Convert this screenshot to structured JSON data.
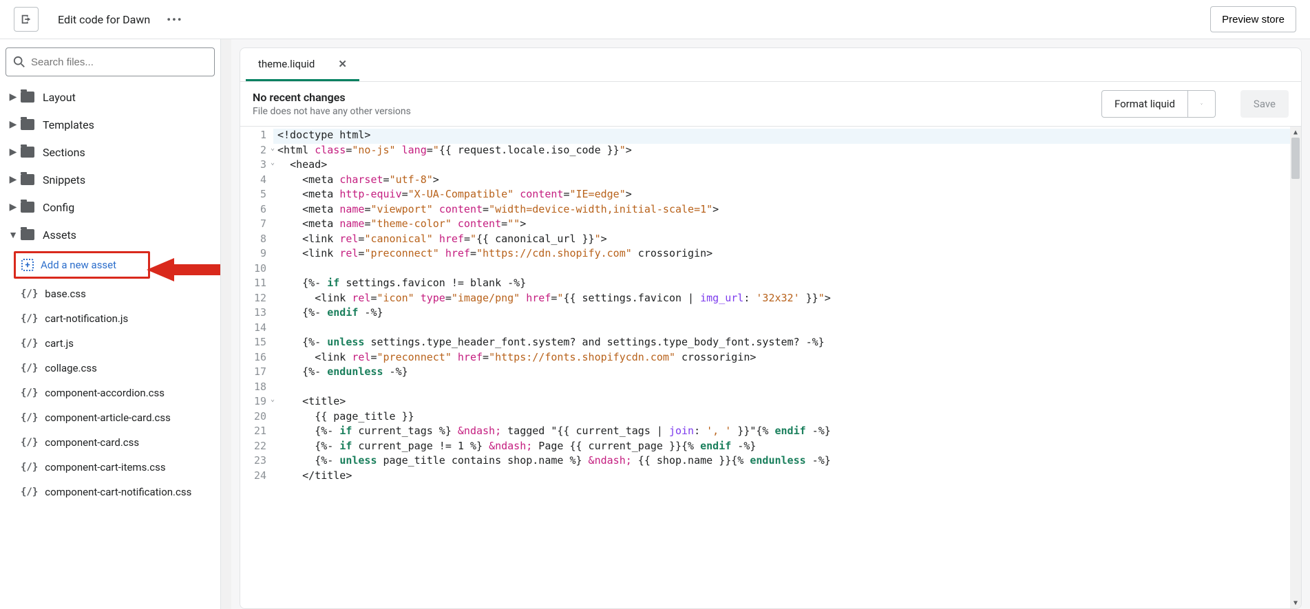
{
  "header": {
    "title": "Edit code for Dawn",
    "preview": "Preview store"
  },
  "search": {
    "placeholder": "Search files..."
  },
  "folders": [
    {
      "label": "Layout",
      "expanded": false
    },
    {
      "label": "Templates",
      "expanded": false
    },
    {
      "label": "Sections",
      "expanded": false
    },
    {
      "label": "Snippets",
      "expanded": false
    },
    {
      "label": "Config",
      "expanded": false
    },
    {
      "label": "Assets",
      "expanded": true
    }
  ],
  "add_asset": "Add a new asset",
  "files": [
    "base.css",
    "cart-notification.js",
    "cart.js",
    "collage.css",
    "component-accordion.css",
    "component-article-card.css",
    "component-card.css",
    "component-cart-items.css",
    "component-cart-notification.css"
  ],
  "tab": {
    "name": "theme.liquid"
  },
  "status": {
    "title": "No recent changes",
    "sub": "File does not have any other versions"
  },
  "actions": {
    "format": "Format liquid",
    "save": "Save"
  },
  "code_lines": [
    {
      "n": 1,
      "fold": false,
      "html": "<span class='t-txt'>&lt;!doctype html&gt;</span>"
    },
    {
      "n": 2,
      "fold": true,
      "html": "<span class='t-txt'>&lt;html </span><span class='t-attr'>class</span><span class='t-txt'>=</span><span class='t-str'>\"no-js\"</span><span class='t-txt'> </span><span class='t-attr'>lang</span><span class='t-txt'>=</span><span class='t-str'>\"</span><span class='t-txt'>{{ request.locale.iso_code }}</span><span class='t-str'>\"</span><span class='t-txt'>&gt;</span>"
    },
    {
      "n": 3,
      "fold": true,
      "html": "  <span class='t-txt'>&lt;head&gt;</span>"
    },
    {
      "n": 4,
      "fold": false,
      "html": "    <span class='t-txt'>&lt;meta </span><span class='t-attr'>charset</span><span class='t-txt'>=</span><span class='t-str'>\"utf-8\"</span><span class='t-txt'>&gt;</span>"
    },
    {
      "n": 5,
      "fold": false,
      "html": "    <span class='t-txt'>&lt;meta </span><span class='t-attr'>http-equiv</span><span class='t-txt'>=</span><span class='t-str'>\"X-UA-Compatible\"</span><span class='t-txt'> </span><span class='t-attr'>content</span><span class='t-txt'>=</span><span class='t-str'>\"IE=edge\"</span><span class='t-txt'>&gt;</span>"
    },
    {
      "n": 6,
      "fold": false,
      "html": "    <span class='t-txt'>&lt;meta </span><span class='t-attr'>name</span><span class='t-txt'>=</span><span class='t-str'>\"viewport\"</span><span class='t-txt'> </span><span class='t-attr'>content</span><span class='t-txt'>=</span><span class='t-str'>\"width=device-width,initial-scale=1\"</span><span class='t-txt'>&gt;</span>"
    },
    {
      "n": 7,
      "fold": false,
      "html": "    <span class='t-txt'>&lt;meta </span><span class='t-attr'>name</span><span class='t-txt'>=</span><span class='t-str'>\"theme-color\"</span><span class='t-txt'> </span><span class='t-attr'>content</span><span class='t-txt'>=</span><span class='t-str'>\"\"</span><span class='t-txt'>&gt;</span>"
    },
    {
      "n": 8,
      "fold": false,
      "html": "    <span class='t-txt'>&lt;link </span><span class='t-attr'>rel</span><span class='t-txt'>=</span><span class='t-str'>\"canonical\"</span><span class='t-txt'> </span><span class='t-attr'>href</span><span class='t-txt'>=</span><span class='t-str'>\"</span><span class='t-txt'>{{ canonical_url }}</span><span class='t-str'>\"</span><span class='t-txt'>&gt;</span>"
    },
    {
      "n": 9,
      "fold": false,
      "html": "    <span class='t-txt'>&lt;link </span><span class='t-attr'>rel</span><span class='t-txt'>=</span><span class='t-str'>\"preconnect\"</span><span class='t-txt'> </span><span class='t-attr'>href</span><span class='t-txt'>=</span><span class='t-str'>\"https://cdn.shopify.com\"</span><span class='t-txt'> crossorigin&gt;</span>"
    },
    {
      "n": 10,
      "fold": false,
      "html": ""
    },
    {
      "n": 11,
      "fold": false,
      "html": "    <span class='t-txt'>{%- </span><span class='t-kw'>if</span><span class='t-txt'> settings.favicon != blank -%}</span>"
    },
    {
      "n": 12,
      "fold": false,
      "html": "      <span class='t-txt'>&lt;link </span><span class='t-attr'>rel</span><span class='t-txt'>=</span><span class='t-str'>\"icon\"</span><span class='t-txt'> </span><span class='t-attr'>type</span><span class='t-txt'>=</span><span class='t-str'>\"image/png\"</span><span class='t-txt'> </span><span class='t-attr'>href</span><span class='t-txt'>=</span><span class='t-str'>\"</span><span class='t-txt'>{{ settings.favicon | </span><span class='t-fn'>img_url</span><span class='t-txt'>: </span><span class='t-str'>'32x32'</span><span class='t-txt'> }}</span><span class='t-str'>\"</span><span class='t-txt'>&gt;</span>"
    },
    {
      "n": 13,
      "fold": false,
      "html": "    <span class='t-txt'>{%- </span><span class='t-kw'>endif</span><span class='t-txt'> -%}</span>"
    },
    {
      "n": 14,
      "fold": false,
      "html": ""
    },
    {
      "n": 15,
      "fold": false,
      "html": "    <span class='t-txt'>{%- </span><span class='t-kw'>unless</span><span class='t-txt'> settings.type_header_font.system? and settings.type_body_font.system? -%}</span>"
    },
    {
      "n": 16,
      "fold": false,
      "html": "      <span class='t-txt'>&lt;link </span><span class='t-attr'>rel</span><span class='t-txt'>=</span><span class='t-str'>\"preconnect\"</span><span class='t-txt'> </span><span class='t-attr'>href</span><span class='t-txt'>=</span><span class='t-str'>\"https://fonts.shopifycdn.com\"</span><span class='t-txt'> crossorigin&gt;</span>"
    },
    {
      "n": 17,
      "fold": false,
      "html": "    <span class='t-txt'>{%- </span><span class='t-kw'>endunless</span><span class='t-txt'> -%}</span>"
    },
    {
      "n": 18,
      "fold": false,
      "html": ""
    },
    {
      "n": 19,
      "fold": true,
      "html": "    <span class='t-txt'>&lt;title&gt;</span>"
    },
    {
      "n": 20,
      "fold": false,
      "html": "      <span class='t-txt'>{{ page_title }}</span>"
    },
    {
      "n": 21,
      "fold": false,
      "html": "      <span class='t-txt'>{%- </span><span class='t-kw'>if</span><span class='t-txt'> current_tags %} </span><span class='t-attr'>&amp;ndash;</span><span class='t-txt'> tagged \"{{ current_tags | </span><span class='t-fn'>join</span><span class='t-txt'>: </span><span class='t-str'>', '</span><span class='t-txt'> }}\"{% </span><span class='t-kw'>endif</span><span class='t-txt'> -%}</span>"
    },
    {
      "n": 22,
      "fold": false,
      "html": "      <span class='t-txt'>{%- </span><span class='t-kw'>if</span><span class='t-txt'> current_page != 1 %} </span><span class='t-attr'>&amp;ndash;</span><span class='t-txt'> Page {{ current_page }}{% </span><span class='t-kw'>endif</span><span class='t-txt'> -%}</span>"
    },
    {
      "n": 23,
      "fold": false,
      "html": "      <span class='t-txt'>{%- </span><span class='t-kw'>unless</span><span class='t-txt'> page_title contains shop.name %} </span><span class='t-attr'>&amp;ndash;</span><span class='t-txt'> {{ shop.name }}{% </span><span class='t-kw'>endunless</span><span class='t-txt'> -%}</span>"
    },
    {
      "n": 24,
      "fold": false,
      "html": "    <span class='t-txt'>&lt;/title&gt;</span>"
    }
  ]
}
